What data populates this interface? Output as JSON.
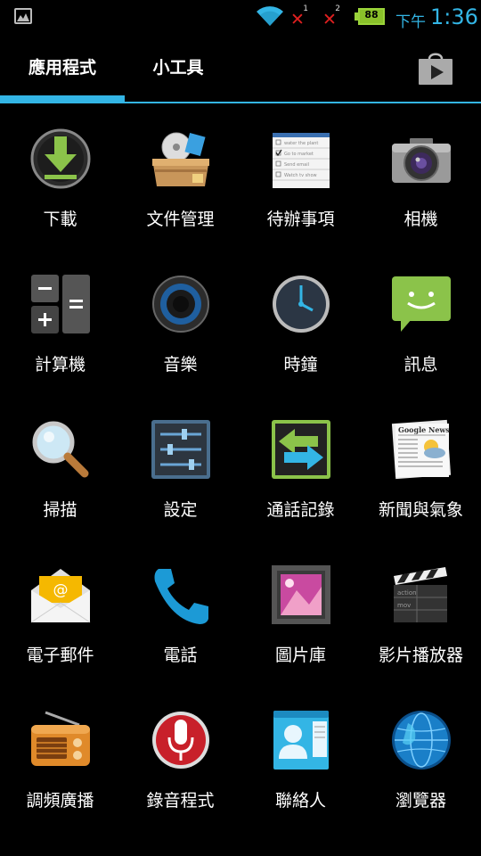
{
  "status_bar": {
    "sim1_label": "1",
    "sim2_label": "2",
    "battery_level": "88",
    "ampm": "下午",
    "time": "1:36",
    "accent_color": "#33b5e5"
  },
  "tabs": [
    {
      "label": "應用程式",
      "selected": true
    },
    {
      "label": "小工具",
      "selected": false
    }
  ],
  "apps": [
    {
      "label": "下載",
      "icon": "download-icon"
    },
    {
      "label": "文件管理",
      "icon": "file-manager-icon"
    },
    {
      "label": "待辦事項",
      "icon": "todo-icon",
      "todo_lines": [
        "water the plant",
        "Go to market",
        "Send email",
        "Watch tv show"
      ]
    },
    {
      "label": "相機",
      "icon": "camera-icon"
    },
    {
      "label": "計算機",
      "icon": "calculator-icon"
    },
    {
      "label": "音樂",
      "icon": "music-icon"
    },
    {
      "label": "時鐘",
      "icon": "clock-icon"
    },
    {
      "label": "訊息",
      "icon": "messaging-icon"
    },
    {
      "label": "掃描",
      "icon": "scan-icon"
    },
    {
      "label": "設定",
      "icon": "settings-icon"
    },
    {
      "label": "通話記錄",
      "icon": "call-log-icon"
    },
    {
      "label": "新聞與氣象",
      "icon": "news-weather-icon",
      "newspaper_title": "Google News"
    },
    {
      "label": "電子郵件",
      "icon": "email-icon"
    },
    {
      "label": "電話",
      "icon": "phone-icon"
    },
    {
      "label": "圖片庫",
      "icon": "gallery-icon"
    },
    {
      "label": "影片播放器",
      "icon": "video-player-icon",
      "clapper_lines": [
        "action",
        "mov"
      ]
    },
    {
      "label": "調頻廣播",
      "icon": "fm-radio-icon"
    },
    {
      "label": "錄音程式",
      "icon": "sound-recorder-icon"
    },
    {
      "label": "聯絡人",
      "icon": "contacts-icon"
    },
    {
      "label": "瀏覽器",
      "icon": "browser-icon"
    }
  ]
}
